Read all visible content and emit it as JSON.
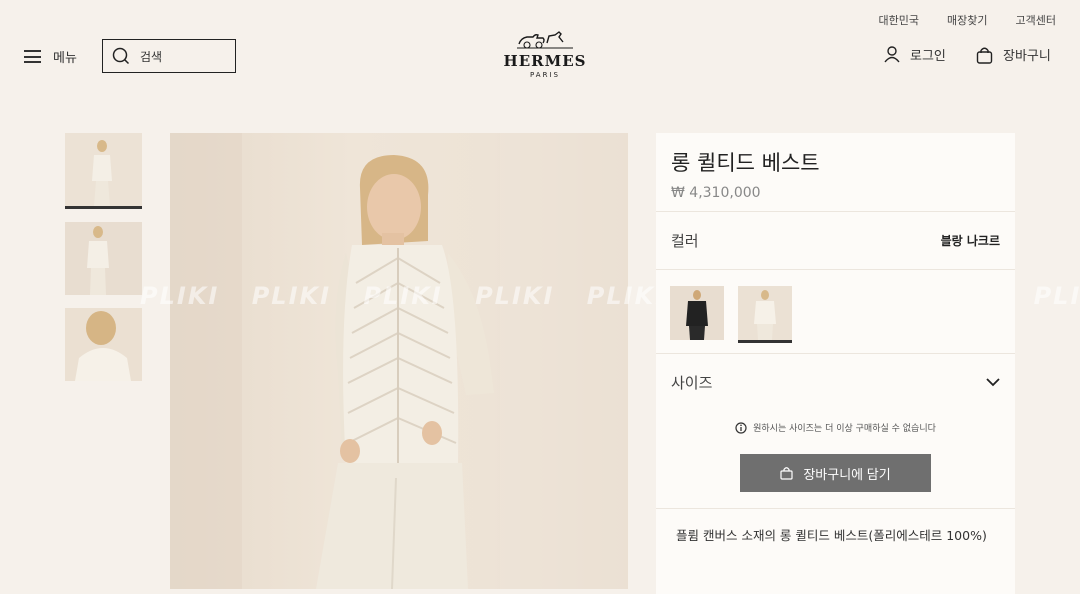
{
  "header": {
    "util_links": [
      "대한민국",
      "매장찾기",
      "고객센터"
    ],
    "menu_label": "메뉴",
    "search_placeholder": "검색",
    "logo_text": "HERMES",
    "logo_sub": "PARIS",
    "login_label": "로그인",
    "cart_label": "장바구니"
  },
  "product": {
    "title": "롱 퀼티드 베스트",
    "price": "₩ 4,310,000",
    "color_label": "컬러",
    "color_value": "블랑 나크르",
    "size_label": "사이즈",
    "notice": "원하시는 사이즈는 더 이상 구매하실 수 없습니다",
    "add_to_cart": "장바구니에 담기",
    "description": "플륌 캔버스 소재의 롱 퀼티드 베스트(폴리에스테르 100%)"
  },
  "watermark": "PLIKI PLIKI PLIKI PLIKI PLIKI PLIKI PLIKI PLIKI PLIKI",
  "icons": [
    "hamburger-icon",
    "search-icon",
    "user-icon",
    "bag-icon",
    "chevron-down-icon",
    "info-icon"
  ]
}
